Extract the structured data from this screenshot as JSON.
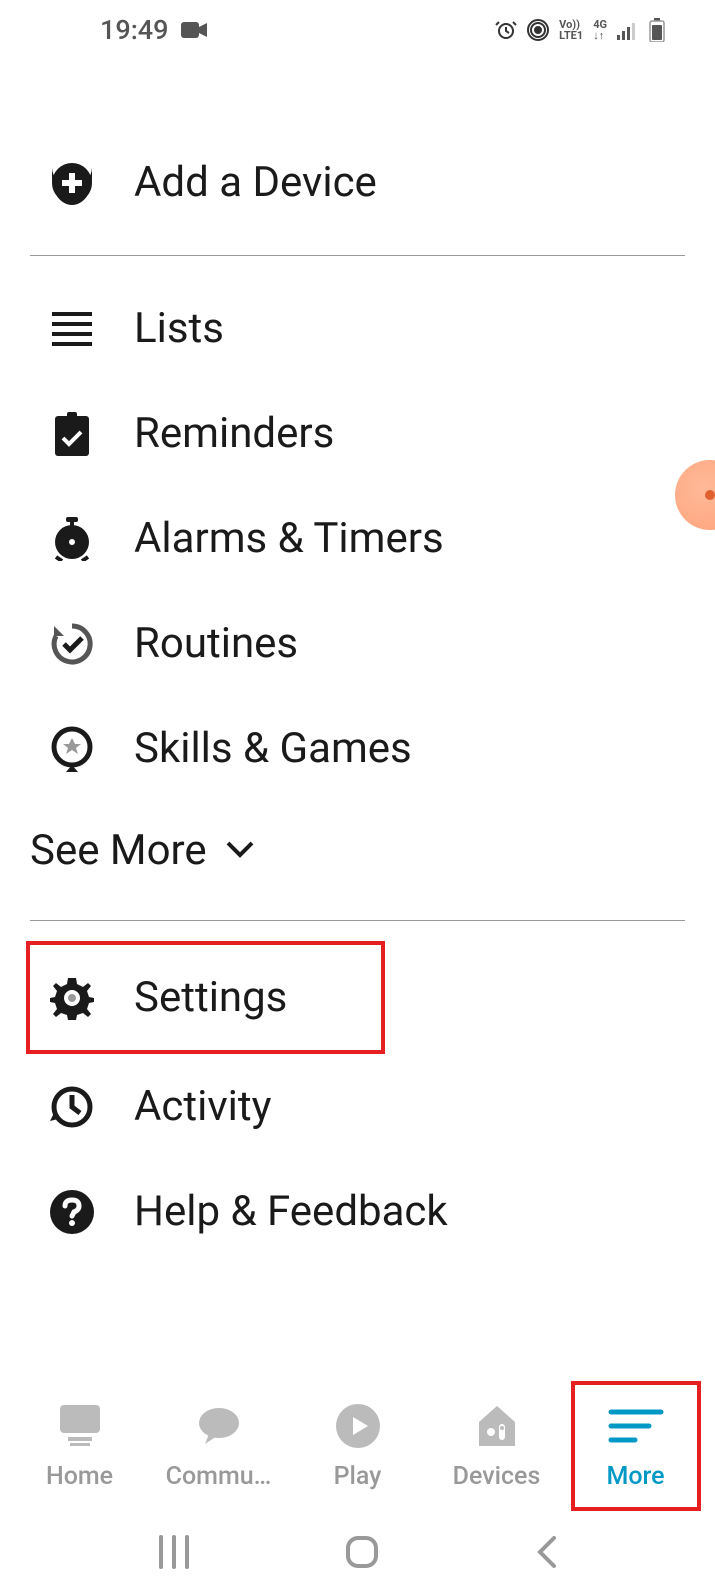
{
  "status": {
    "time": "19:49",
    "lte_top": "Vo))",
    "lte_bottom": "LTE1",
    "network": "4G"
  },
  "menu": {
    "add_device": "Add a Device",
    "lists": "Lists",
    "reminders": "Reminders",
    "alarms": "Alarms & Timers",
    "routines": "Routines",
    "skills": "Skills & Games",
    "see_more": "See More",
    "settings": "Settings",
    "activity": "Activity",
    "help": "Help & Feedback"
  },
  "nav": {
    "home": "Home",
    "communicate": "Commu…",
    "play": "Play",
    "devices": "Devices",
    "more": "More"
  }
}
